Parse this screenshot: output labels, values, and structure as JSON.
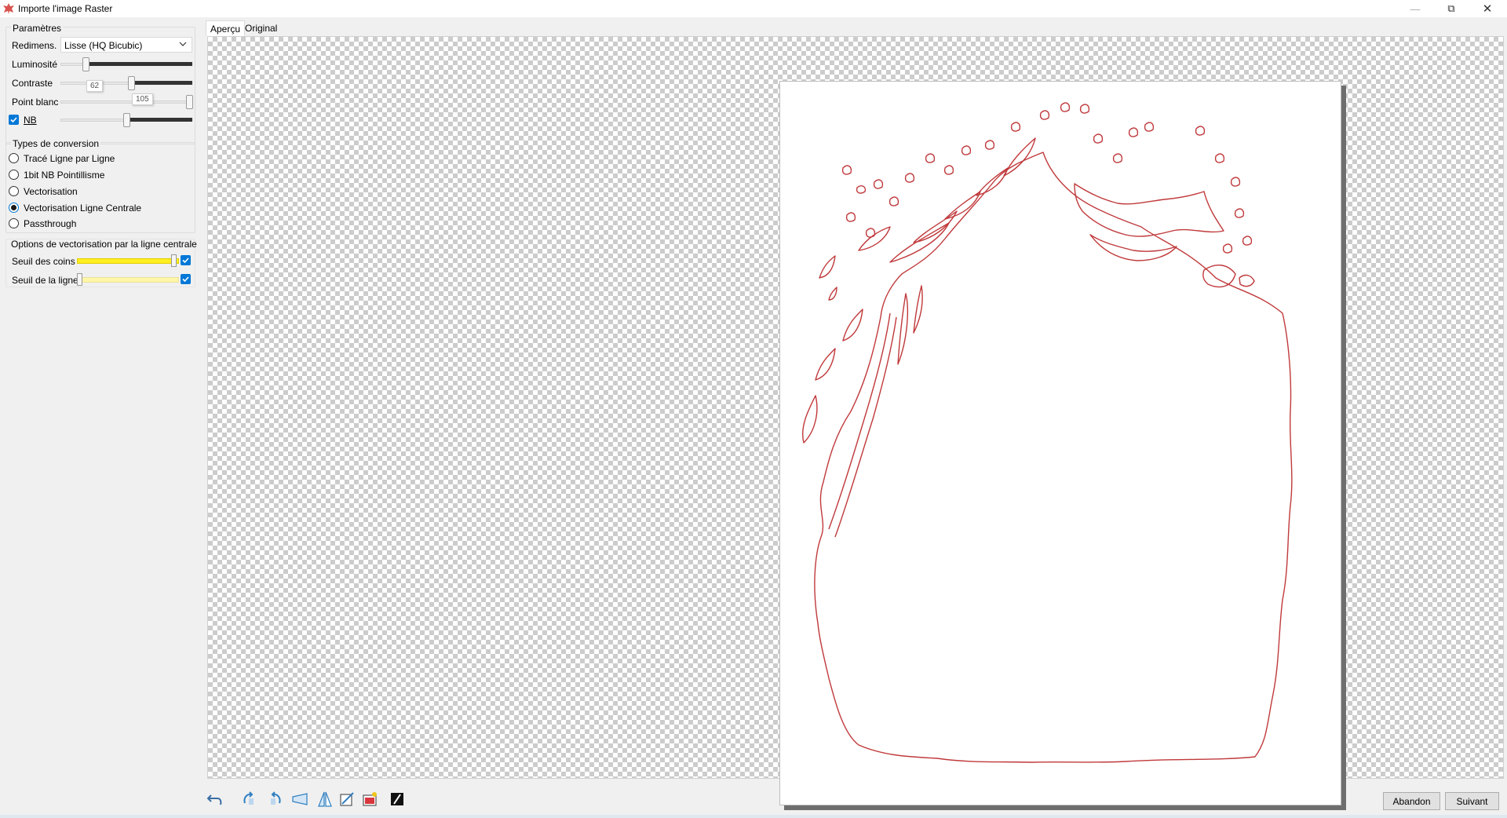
{
  "window": {
    "title": "Importe l'image Raster",
    "minimize_glyph": "—",
    "maximize_glyph": "⧉",
    "close_glyph": "✕"
  },
  "parametres": {
    "title": "Paramètres",
    "redimens_label": "Redimens.",
    "redimens_value": "Lisse (HQ Bicubic)",
    "luminosite_label": "Luminosité",
    "luminosite_level": 0.2,
    "contraste_label": "Contraste",
    "contraste_value": "62",
    "contraste_level": 0.53,
    "point_blanc_label": "Point blanc",
    "point_blanc_value": "105",
    "point_blanc_level": 1.0,
    "nb_label": "NB",
    "nb_checked": true,
    "nb_level": 0.5
  },
  "conversion": {
    "title": "Types de conversion",
    "options": [
      {
        "label": "Tracé Ligne par Ligne",
        "checked": false
      },
      {
        "label": "1bit NB Pointillisme",
        "checked": false
      },
      {
        "label": "Vectorisation",
        "checked": false
      },
      {
        "label": "Vectorisation Ligne Centrale",
        "checked": true
      },
      {
        "label": "Passthrough",
        "checked": false
      }
    ]
  },
  "centerline": {
    "title": "Options de vectorisation par la ligne centrale",
    "seuil_coins_label": "Seuil des coins",
    "seuil_coins_level": 1.0,
    "seuil_coins_checked": true,
    "seuil_ligne_label": "Seuil de la ligne",
    "seuil_ligne_level": 0.0,
    "seuil_ligne_checked": true
  },
  "tabs": {
    "apercu": "Aperçu",
    "original": "Original"
  },
  "buttons": {
    "abandon": "Abandon",
    "suivant": "Suivant"
  },
  "colors": {
    "accent": "#0078d7",
    "trace_line": "#c0393b",
    "slider_yellow": "#ffee22"
  },
  "toolbar_icons": [
    "undo-icon",
    "rotate-left-icon",
    "rotate-right-icon",
    "flip-horizontal-icon",
    "flip-vertical-icon",
    "crop-icon",
    "color-picker-icon",
    "invert-icon"
  ]
}
